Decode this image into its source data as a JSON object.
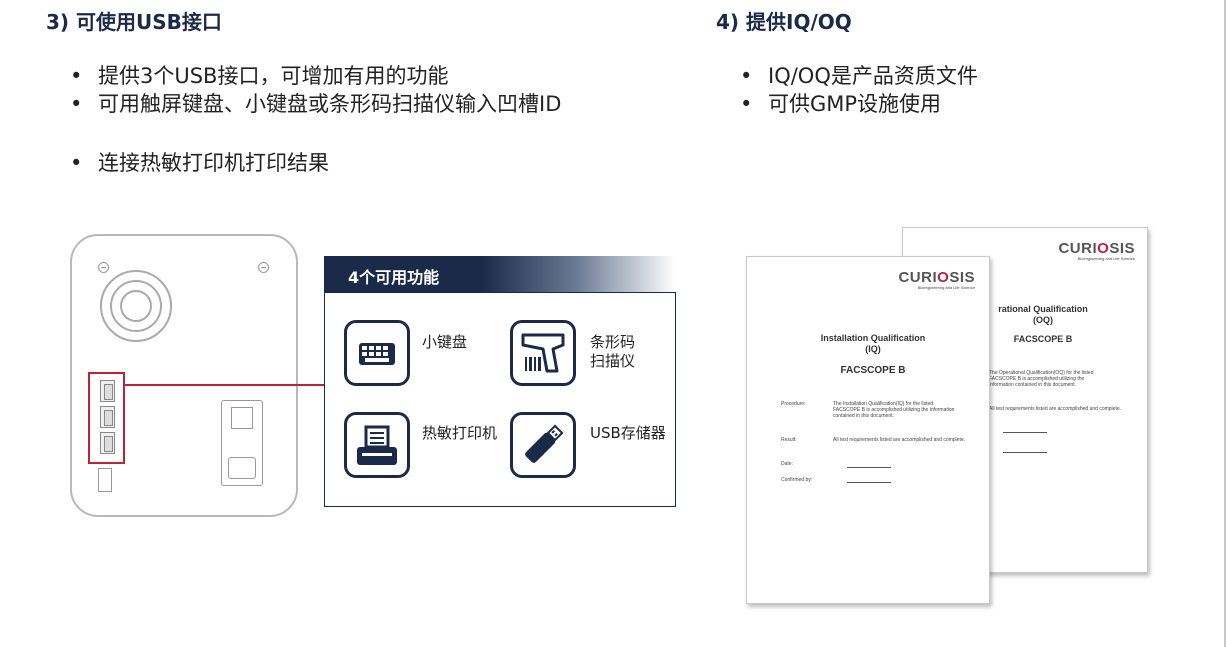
{
  "left": {
    "heading": "3) 可使用USB接口",
    "bullets": [
      "提供3个USB接口，可增加有用的功能",
      "可用触屏键盘、小键盘或条形码扫描仪输入凹槽ID",
      "连接热敏打印机打印结果"
    ]
  },
  "right": {
    "heading": "4) 提供IQ/OQ",
    "bullets": [
      "IQ/OQ是产品资质文件",
      "可供GMP设施使用"
    ]
  },
  "features": {
    "title": "4个可用功能",
    "items": [
      {
        "label": "小键盘",
        "icon": "keyboard-icon"
      },
      {
        "label": "条形码\n扫描仪",
        "icon": "barcode-scanner-icon"
      },
      {
        "label": "热敏打印机",
        "icon": "printer-icon"
      },
      {
        "label": "USB存储器",
        "icon": "usb-stick-icon"
      }
    ]
  },
  "iq_doc": {
    "logo": "CURIOSIS",
    "logo_sub": "Bioengineering and Life Science",
    "title_line1": "Installation Qualification",
    "title_line2": "(IQ)",
    "product": "FACSCOPE B",
    "procedure_label": "Procedure:",
    "procedure_text": "The Installation Qualification(IQ) for the listed FACSCOPE B is accomplished utilizing the information contained in this document.",
    "result_label": "Result:",
    "result_text": "All test requirements listed are accomplished and complete.",
    "date_label": "Date:",
    "confirmed_label": "Confirmed by:"
  },
  "oq_doc": {
    "logo": "CURIOSIS",
    "logo_sub": "Bioengineering and Life Science",
    "title_line1": "rational Qualification",
    "title_line2": "(OQ)",
    "product": "FACSCOPE B",
    "procedure_text": "The Operational Qualification(OQ) for the listed FACSCOPE B is accomplished utilizing the information contained in this document.",
    "result_text": "All test requirements listed are accomplished and complete."
  },
  "colors": {
    "navy": "#1c2a4a",
    "accent_red": "#c0203a"
  }
}
